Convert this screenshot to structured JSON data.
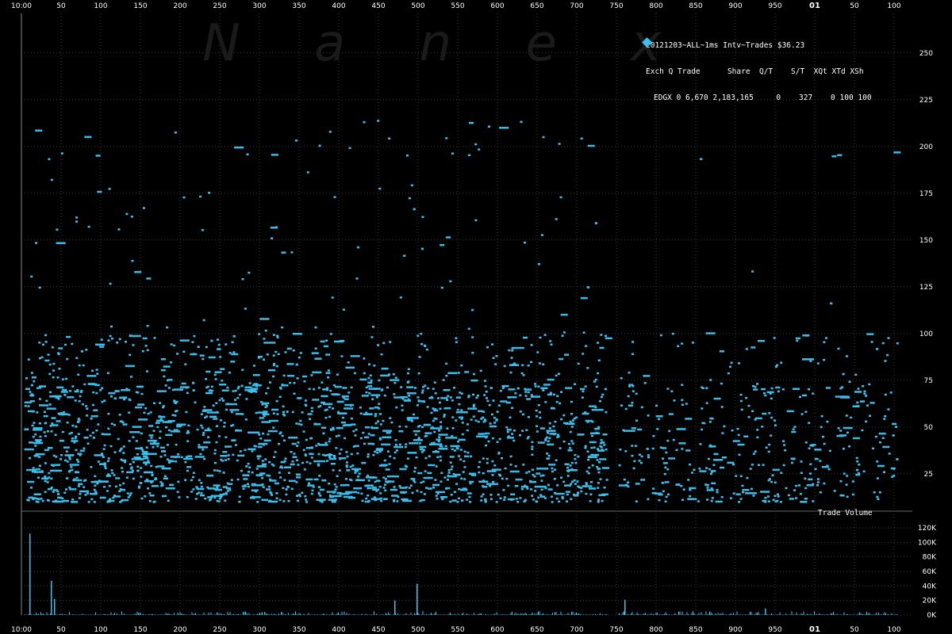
{
  "watermark": [
    "N",
    "a",
    "n",
    "e",
    "x"
  ],
  "header": {
    "title": "20121203~ALL~1ms Intv~Trades $36.23",
    "columns": "Exch Q Trade      Share  Q/T    S/T  XQt XTd XSh",
    "row": "EDGX 0 6,670 2,183,165     0    327    0 100 100"
  },
  "colors": {
    "background": "#000000",
    "trades": "#36c2f0",
    "grid": "#3a3a3a",
    "text": "#ffffff"
  },
  "volume_label": "Trade Volume",
  "top_x_ticks": [
    "10:00",
    "50",
    "100",
    "150",
    "200",
    "250",
    "300",
    "350",
    "400",
    "450",
    "500",
    "550",
    "600",
    "650",
    "700",
    "750",
    "800",
    "850",
    "900",
    "950",
    "01",
    "50",
    "100"
  ],
  "bottom_x_ticks": [
    "10:00",
    "50",
    "100",
    "150",
    "200",
    "250",
    "300",
    "350",
    "400",
    "450",
    "500",
    "550",
    "600",
    "650",
    "700",
    "750",
    "800",
    "850",
    "900",
    "950",
    "01",
    "50",
    "100"
  ],
  "chart_data": [
    {
      "type": "scatter",
      "name": "trades",
      "xlabel": "",
      "ylabel": "",
      "ylim": [
        5,
        255
      ],
      "yticks": [
        25,
        50,
        75,
        100,
        125,
        150,
        175,
        200,
        225,
        250
      ],
      "x_ticks": [
        "10:00",
        "50",
        "100",
        "150",
        "200",
        "250",
        "300",
        "350",
        "400",
        "450",
        "500",
        "550",
        "600",
        "650",
        "700",
        "750",
        "800",
        "850",
        "900",
        "950",
        "01",
        "50",
        "100"
      ],
      "grid": true,
      "note_points": "dense cloud of trade sizes between ~10 and ~75 shares across the hour; sparse points up to ~215"
    },
    {
      "type": "bar",
      "name": "volume",
      "title": "Trade Volume",
      "ylim": [
        0,
        120000
      ],
      "yticks": [
        "0K",
        "20K",
        "40K",
        "60K",
        "80K",
        "100K",
        "120K"
      ],
      "spikes": [
        {
          "x": 10,
          "value": 112000
        },
        {
          "x": 37,
          "value": 47000
        },
        {
          "x": 41,
          "value": 22000
        },
        {
          "x": 498,
          "value": 43000
        },
        {
          "x": 470,
          "value": 20000
        },
        {
          "x": 760,
          "value": 21000
        },
        {
          "x": 937,
          "value": 9000
        }
      ]
    }
  ]
}
